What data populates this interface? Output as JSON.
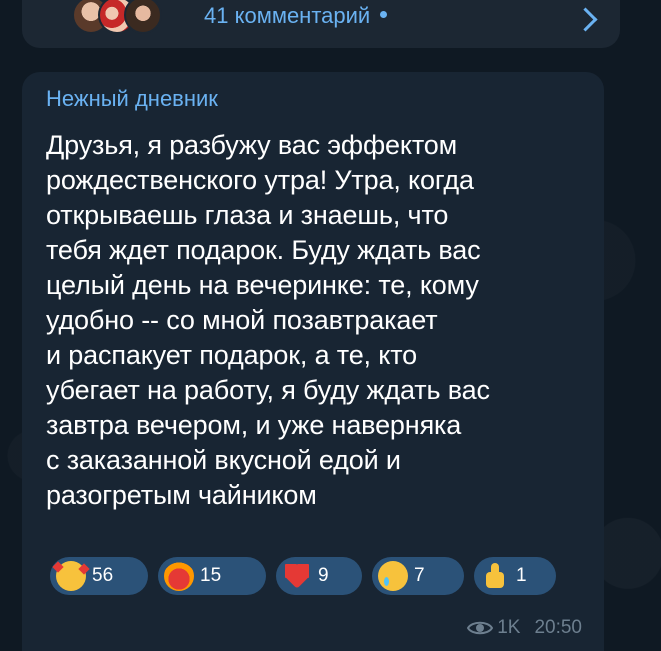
{
  "comments": {
    "label": "41 комментарий"
  },
  "post": {
    "author": "Нежный дневник",
    "lines": [
      "Друзья, я разбужу вас эффектом",
      "рождественского утра! Утра, когда",
      "открываешь глаза и знаешь, что",
      "тебя ждет подарок. Буду ждать вас",
      "целый день на вечеринке: те, кому",
      "удобно -- со мной позавтракает",
      "и распакует подарок, а те, кто",
      "убегает на работу, я буду ждать вас",
      "завтра вечером, и уже наверняка",
      "с заказанной вкусной едой и",
      "разогретым чайником"
    ],
    "reactions": [
      {
        "icon": "smiling-face-with-hearts-icon",
        "count": "56"
      },
      {
        "icon": "heart-on-fire-icon",
        "count": "15"
      },
      {
        "icon": "red-heart-icon",
        "count": "9"
      },
      {
        "icon": "crying-face-icon",
        "count": "7"
      },
      {
        "icon": "thumbs-up-icon",
        "count": "1"
      }
    ],
    "views": "1K",
    "time": "20:50"
  },
  "colors": {
    "accent": "#6ab2f2",
    "bubble": "#182533",
    "reaction_bg": "#2b5278",
    "meta": "#6d7f8f"
  }
}
